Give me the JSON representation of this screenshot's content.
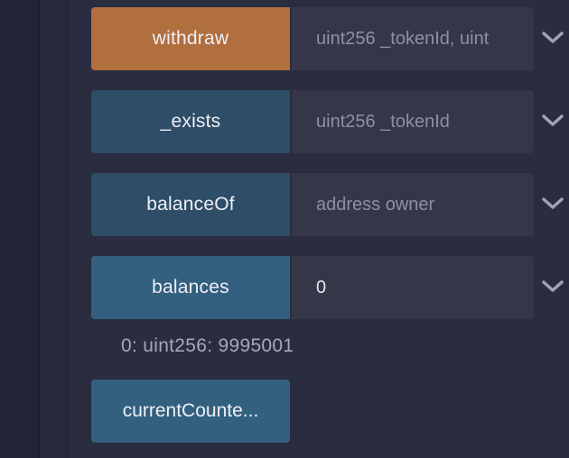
{
  "functions": [
    {
      "name": "withdraw",
      "style": "orange",
      "placeholder": "uint256 _tokenId, uint",
      "value": ""
    },
    {
      "name": "_exists",
      "style": "dark",
      "placeholder": "uint256 _tokenId",
      "value": ""
    },
    {
      "name": "balanceOf",
      "style": "dark",
      "placeholder": "address owner",
      "value": ""
    },
    {
      "name": "balances",
      "style": "blue",
      "placeholder": "",
      "value": "0"
    }
  ],
  "balances_result": "0: uint256: 9995001",
  "current_counter_button": "currentCounte...",
  "icons": {
    "expand": "chevron-down-icon"
  },
  "colors": {
    "transact": "#b16f3e",
    "call": "#2e4d66",
    "call_active": "#33607f",
    "panel": "#2a2c3f"
  }
}
